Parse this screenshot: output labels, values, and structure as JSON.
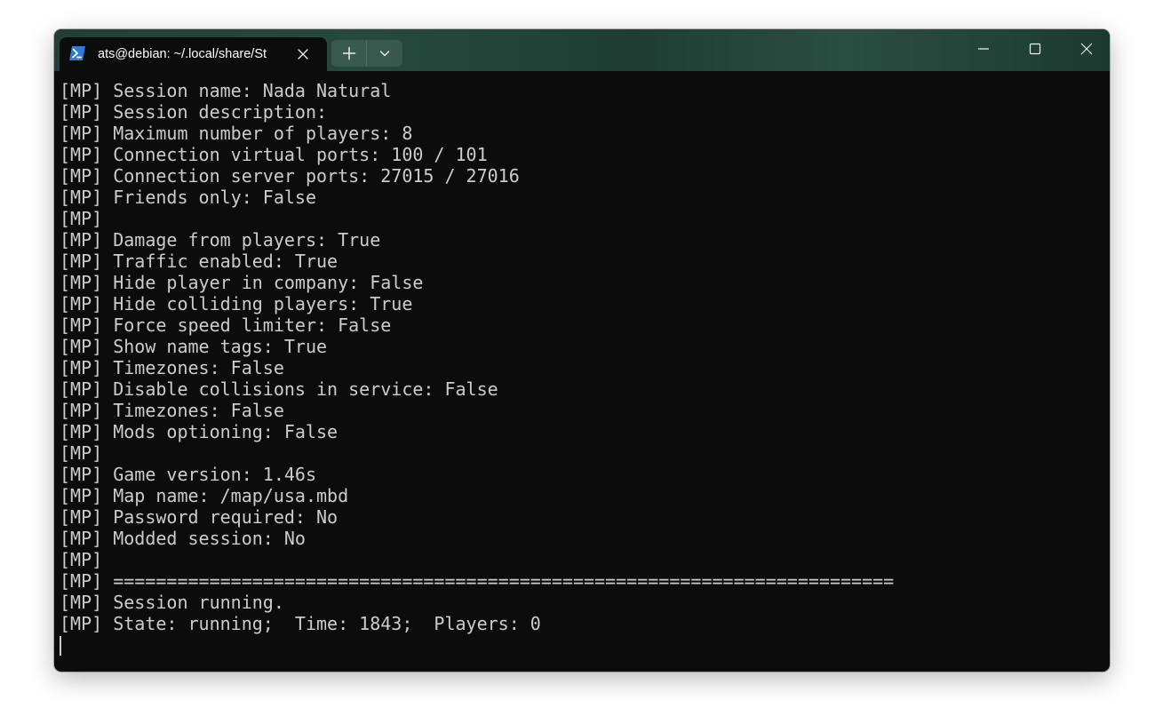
{
  "window": {
    "tab_title": "ats@debian: ~/.local/share/St",
    "tab_icon": "powershell-icon",
    "buttons": {
      "new_tab": "plus-icon",
      "dropdown": "chevron-down-icon",
      "minimize": "minimize-icon",
      "maximize": "maximize-icon",
      "close": "close-icon"
    }
  },
  "colors": {
    "titlebar": "#213f34",
    "terminal_bg": "#0c0c0c",
    "terminal_fg": "#cccccc"
  },
  "terminal": {
    "lines": [
      "[MP] Session name: Nada Natural",
      "[MP] Session description:",
      "[MP] Maximum number of players: 8",
      "[MP] Connection virtual ports: 100 / 101",
      "[MP] Connection server ports: 27015 / 27016",
      "[MP] Friends only: False",
      "[MP]",
      "[MP] Damage from players: True",
      "[MP] Traffic enabled: True",
      "[MP] Hide player in company: False",
      "[MP] Hide colliding players: True",
      "[MP] Force speed limiter: False",
      "[MP] Show name tags: True",
      "[MP] Timezones: False",
      "[MP] Disable collisions in service: False",
      "[MP] Timezones: False",
      "[MP] Mods optioning: False",
      "[MP]",
      "[MP] Game version: 1.46s",
      "[MP] Map name: /map/usa.mbd",
      "[MP] Password required: No",
      "[MP] Modded session: No",
      "[MP]",
      "[MP] =========================================================================",
      "[MP] Session running.",
      "[MP] State: running;  Time: 1843;  Players: 0"
    ]
  }
}
